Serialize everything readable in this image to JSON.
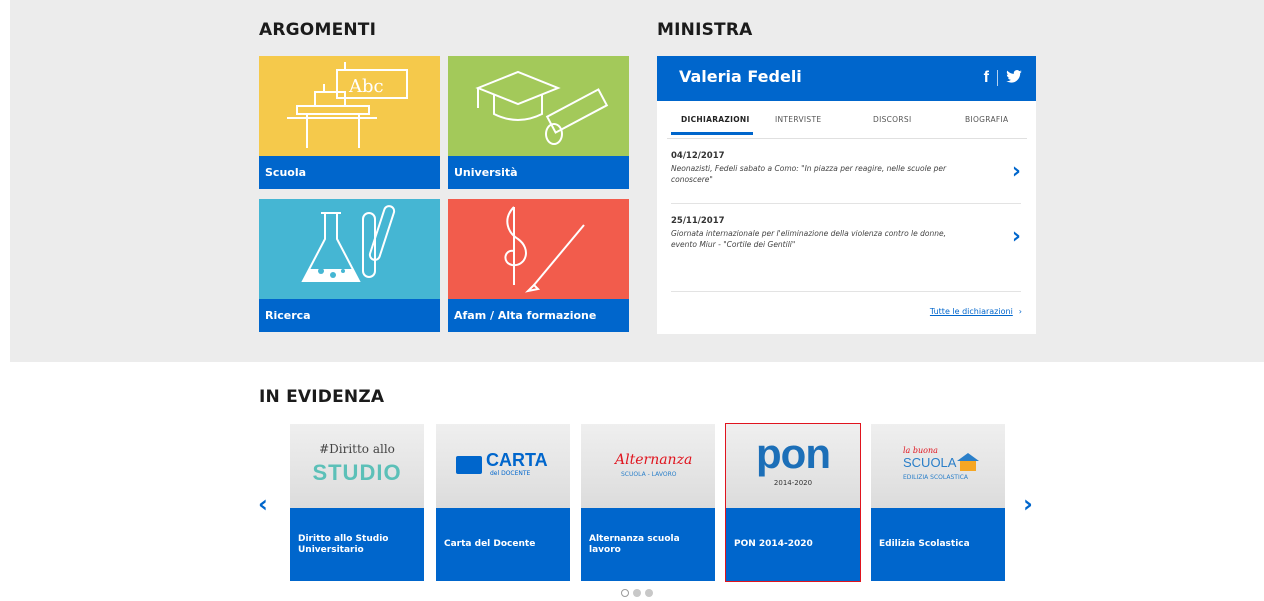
{
  "argomenti": {
    "title": "ARGOMENTI",
    "tiles": [
      {
        "label": "Scuola",
        "color": "#f5c94b",
        "art": "Abc"
      },
      {
        "label": "Università",
        "color": "#a3c95a"
      },
      {
        "label": "Ricerca",
        "color": "#45b6d3"
      },
      {
        "label": "Afam / Alta formazione",
        "color": "#f25c4c"
      }
    ]
  },
  "ministra": {
    "title": "MINISTRA",
    "name": "Valeria Fedeli",
    "social": {
      "facebook": "f",
      "twitter": "twitter-icon"
    },
    "tabs": [
      "DICHIARAZIONI",
      "INTERVISTE",
      "DISCORSI",
      "BIOGRAFIA"
    ],
    "active_tab": "DICHIARAZIONI",
    "declarations": [
      {
        "date": "04/12/2017",
        "text": "Neonazisti, Fedeli sabato a Como: \"In piazza per reagire, nelle scuole per conoscere\""
      },
      {
        "date": "25/11/2017",
        "text": "Giornata internazionale per l'eliminazione della violenza contro le donne, evento Miur - \"Cortile dei Gentili\""
      }
    ],
    "all_link": "Tutte le dichiarazioni",
    "all_link_arrow": "›"
  },
  "evidenza": {
    "title": "IN EVIDENZA",
    "cards": [
      {
        "label": "Diritto allo Studio Universitario",
        "logo_top": "#Diritto allo",
        "logo_bottom": "STUDIO"
      },
      {
        "label": "Carta del Docente",
        "logo_top": "CARTA",
        "logo_bottom": "del DOCENTE"
      },
      {
        "label": "Alternanza scuola lavoro",
        "logo_top": "Alternanza",
        "logo_bottom": "SCUOLA - LAVORO"
      },
      {
        "label": "PON 2014-2020",
        "logo_top": "pon",
        "logo_bottom": "2014-2020"
      },
      {
        "label": "Edilizia Scolastica",
        "logo_top": "la buona",
        "logo_mid": "SCUOLA",
        "logo_bottom": "EDILIZIA SCOLASTICA"
      }
    ],
    "prev": "‹",
    "next": "›",
    "dots": 3,
    "active_dot": 0
  },
  "colors": {
    "brand_blue": "#0066cc",
    "band": "#ececec"
  }
}
